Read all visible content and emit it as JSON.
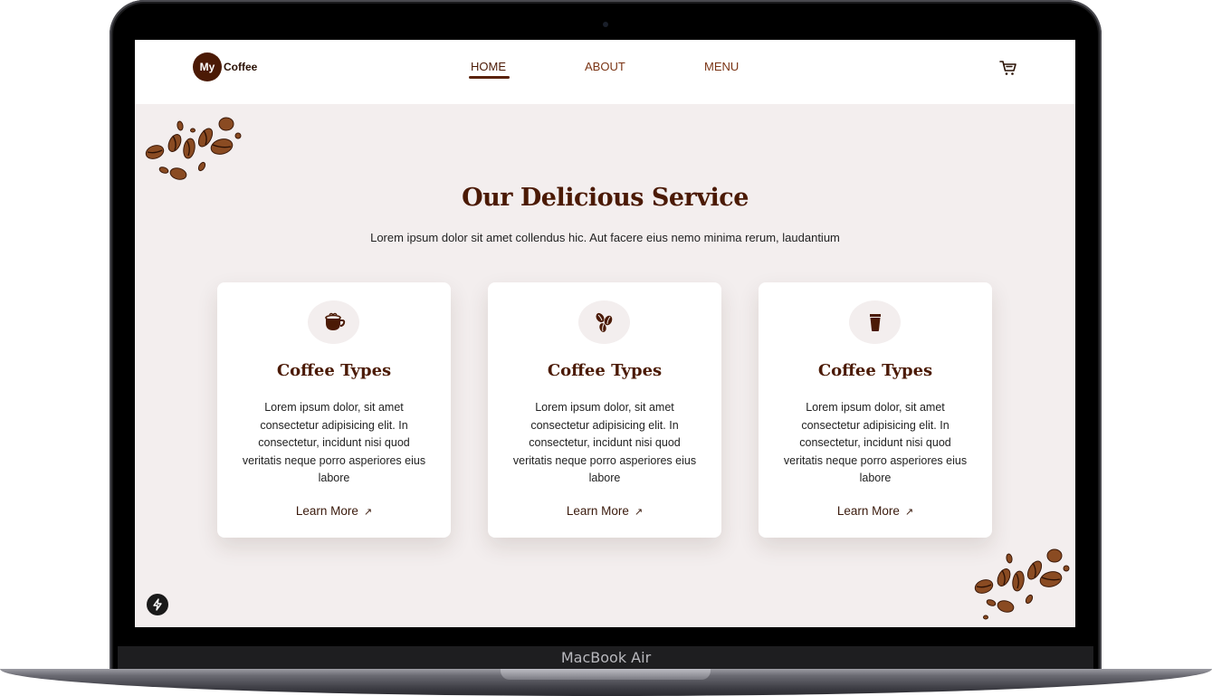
{
  "device": {
    "label": "MacBook Air"
  },
  "brand": {
    "badge": "My",
    "name": "Coffee",
    "color": "#4b1a05"
  },
  "nav": {
    "links": [
      {
        "label": "HOME",
        "active": true
      },
      {
        "label": "ABOUT",
        "active": false
      },
      {
        "label": "MENU",
        "active": false
      }
    ],
    "cart_icon": "shopping-cart-icon"
  },
  "section": {
    "title": "Our Delicious Service",
    "subtitle": "Lorem ipsum dolor sit amet collendus hic. Aut facere eius nemo minima rerum, laudantium"
  },
  "cards": [
    {
      "icon": "coffee-cup-icon",
      "title": "Coffee Types",
      "text": "Lorem ipsum dolor, sit amet consectetur adipisicing elit. In consectetur, incidunt nisi quod veritatis neque porro asperiores eius labore",
      "link": "Learn More",
      "arrow": "↗"
    },
    {
      "icon": "coffee-beans-icon",
      "title": "Coffee Types",
      "text": "Lorem ipsum dolor, sit amet consectetur adipisicing elit. In consectetur, incidunt nisi quod veritatis neque porro asperiores eius labore",
      "link": "Learn More",
      "arrow": "↗"
    },
    {
      "icon": "takeaway-cup-icon",
      "title": "Coffee Types",
      "text": "Lorem ipsum dolor, sit amet consectetur adipisicing elit. In consectetur, incidunt nisi quod veritatis neque porro asperiores eius labore",
      "link": "Learn More",
      "arrow": "↗"
    }
  ],
  "colors": {
    "accent": "#4b1a05",
    "nav_link": "#7a3414",
    "section_bg": "#f3eeee",
    "card_bg": "#ffffff"
  },
  "floating_button": {
    "icon": "lightning-icon"
  }
}
